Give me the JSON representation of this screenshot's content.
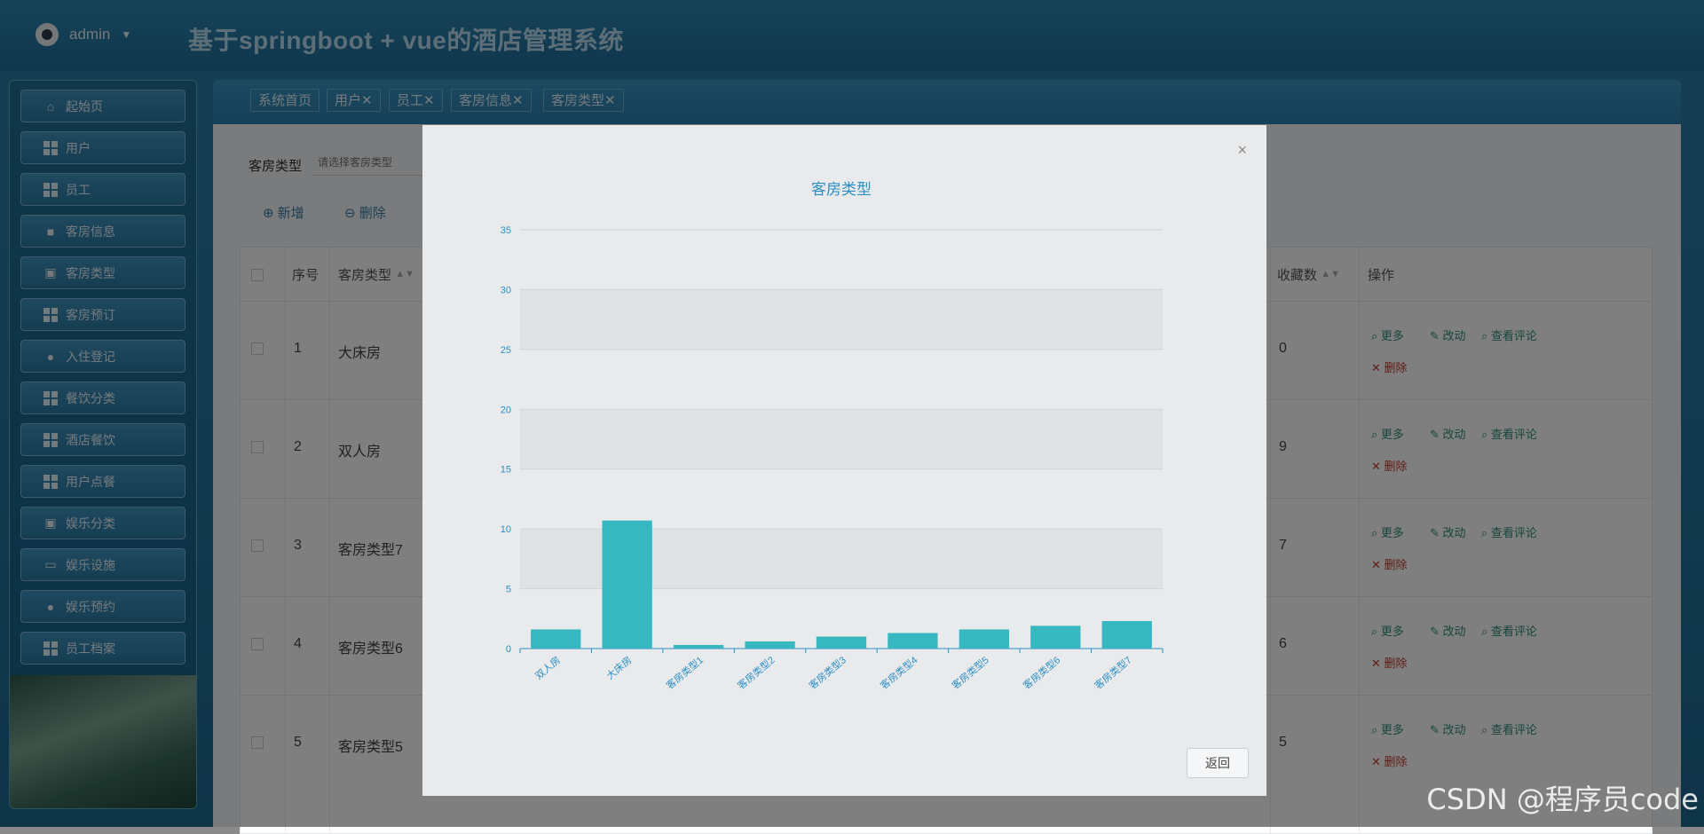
{
  "header": {
    "user": "admin",
    "title": "基于springboot + vue的酒店管理系统"
  },
  "sidebar": {
    "items": [
      {
        "label": "起始页",
        "icon": "home-icon"
      },
      {
        "label": "用户",
        "icon": "grid-icon"
      },
      {
        "label": "员工",
        "icon": "grid-icon"
      },
      {
        "label": "客房信息",
        "icon": "briefcase-icon"
      },
      {
        "label": "客房类型",
        "icon": "clipboard-icon"
      },
      {
        "label": "客房预订",
        "icon": "grid-icon"
      },
      {
        "label": "入住登记",
        "icon": "user-icon"
      },
      {
        "label": "餐饮分类",
        "icon": "grid-icon"
      },
      {
        "label": "酒店餐饮",
        "icon": "grid-icon"
      },
      {
        "label": "用户点餐",
        "icon": "grid-icon"
      },
      {
        "label": "娱乐分类",
        "icon": "clipboard-icon"
      },
      {
        "label": "娱乐设施",
        "icon": "monitor-icon"
      },
      {
        "label": "娱乐预约",
        "icon": "bulb-icon"
      },
      {
        "label": "员工档案",
        "icon": "grid-icon"
      }
    ]
  },
  "tabs": [
    {
      "label": "系统首页"
    },
    {
      "label": "用户✕"
    },
    {
      "label": "员工✕"
    },
    {
      "label": "客房信息✕"
    },
    {
      "label": "客房类型✕"
    }
  ],
  "search": {
    "label": "客房类型",
    "placeholder": "请选择客房类型"
  },
  "toolbar": {
    "add_label": "新增",
    "delete_label": "删除"
  },
  "table": {
    "headers": {
      "index": "序号",
      "type": "客房类型",
      "favorites": "收藏数",
      "actions": "操作"
    },
    "rows": [
      {
        "index": "1",
        "type": "大床房",
        "favorites": "0"
      },
      {
        "index": "2",
        "type": "双人房",
        "favorites": "9"
      },
      {
        "index": "3",
        "type": "客房类型7",
        "favorites": "7"
      },
      {
        "index": "4",
        "type": "客房类型6",
        "favorites": "6"
      },
      {
        "index": "5",
        "type": "客房类型5",
        "favorites": "5"
      }
    ],
    "actions": {
      "more": "更多",
      "edit": "改动",
      "comments": "查看评论",
      "delete": "删除"
    }
  },
  "modal": {
    "return_label": "返回",
    "close_label": "×"
  },
  "chart_data": {
    "type": "bar",
    "title": "客房类型",
    "categories": [
      "双人房",
      "大床房",
      "客房类型1",
      "客房类型2",
      "客房类型3",
      "客房类型4",
      "客房类型5",
      "客房类型6",
      "客房类型7"
    ],
    "values": [
      1.6,
      10.7,
      0.3,
      0.6,
      1.0,
      1.3,
      1.6,
      1.9,
      2.3
    ],
    "ylim": [
      0,
      35
    ],
    "yticks": [
      "0",
      "5",
      "10",
      "15",
      "20",
      "25",
      "30",
      "35"
    ],
    "bar_color": "#37b8c0",
    "axis_color": "#2e8fc4",
    "grid": true
  },
  "watermark": "CSDN @程序员code"
}
